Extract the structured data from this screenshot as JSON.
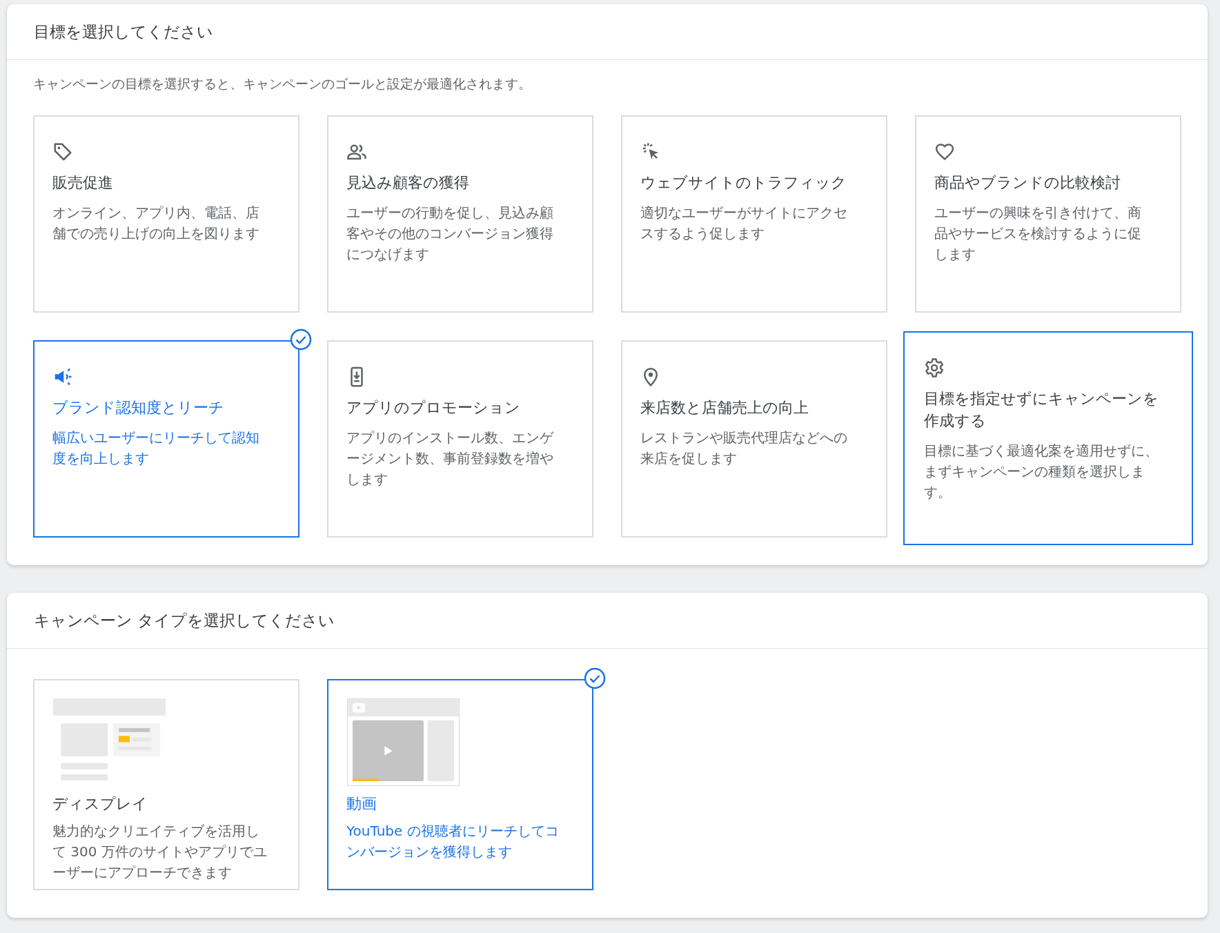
{
  "goal_panel": {
    "title": "目標を選択してください",
    "description": "キャンペーンの目標を選択すると、キャンペーンのゴールと設定が最適化されます。",
    "goals": [
      {
        "title": "販売促進",
        "description": "オンライン、アプリ内、電話、店舗での売り上げの向上を図ります",
        "selected": false,
        "focused": false
      },
      {
        "title": "見込み顧客の獲得",
        "description": "ユーザーの行動を促し、見込み顧客やその他のコンバージョン獲得につなげます",
        "selected": false,
        "focused": false
      },
      {
        "title": "ウェブサイトのトラフィック",
        "description": "適切なユーザーがサイトにアクセスするよう促します",
        "selected": false,
        "focused": false
      },
      {
        "title": "商品やブランドの比較検討",
        "description": "ユーザーの興味を引き付けて、商品やサービスを検討するように促します",
        "selected": false,
        "focused": false
      },
      {
        "title": "ブランド認知度とリーチ",
        "description": "幅広いユーザーにリーチして認知度を向上します",
        "selected": true,
        "focused": false
      },
      {
        "title": "アプリのプロモーション",
        "description": "アプリのインストール数、エンゲージメント数、事前登録数を増やします",
        "selected": false,
        "focused": false
      },
      {
        "title": "来店数と店舗売上の向上",
        "description": "レストランや販売代理店などへの来店を促します",
        "selected": false,
        "focused": false
      },
      {
        "title": "目標を指定せずにキャンペーンを作成する",
        "description": "目標に基づく最適化案を適用せずに、まずキャンペーンの種類を選択します。",
        "selected": false,
        "focused": true
      }
    ]
  },
  "type_panel": {
    "title": "キャンペーン タイプを選択してください",
    "types": [
      {
        "kind": "display",
        "title": "ディスプレイ",
        "description": "魅力的なクリエイティブを活用して 300 万件のサイトやアプリでユーザーにアプローチできます",
        "selected": false
      },
      {
        "kind": "video",
        "title": "動画",
        "description": "YouTube の視聴者にリーチしてコンバージョンを獲得します",
        "selected": true
      }
    ]
  }
}
